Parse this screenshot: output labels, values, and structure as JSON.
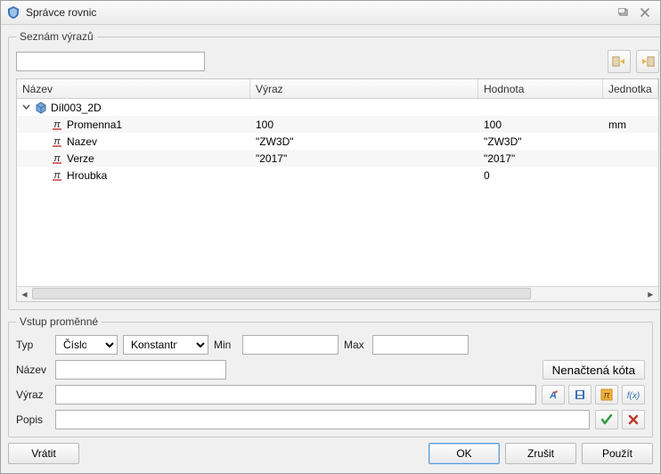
{
  "window": {
    "title": "Správce rovnic"
  },
  "list": {
    "legend": "Seznám výrazů",
    "filter": "",
    "columns": {
      "nazev": "Název",
      "vyraz": "Výraz",
      "hodnota": "Hodnota",
      "jednotka": "Jednotka"
    },
    "root": {
      "name": "Díl003_2D",
      "expanded": true
    },
    "rows": [
      {
        "name": "Promenna1",
        "expr": "100",
        "value": "100",
        "unit": "mm"
      },
      {
        "name": "Nazev",
        "expr": "\"ZW3D\"",
        "value": "\"ZW3D\"",
        "unit": ""
      },
      {
        "name": "Verze",
        "expr": "\"2017\"",
        "value": "\"2017\"",
        "unit": ""
      },
      {
        "name": "Hroubka",
        "expr": "",
        "value": "0",
        "unit": ""
      }
    ]
  },
  "input": {
    "legend": "Vstup proměnné",
    "typ_label": "Typ",
    "typ_value": "Číslo",
    "konst_value": "Konstantní",
    "min_label": "Min",
    "min_value": "",
    "max_label": "Max",
    "max_value": "",
    "nazev_label": "Název",
    "nazev_value": "",
    "unloaded_dim": "Nenačtená kóta",
    "vyraz_label": "Výraz",
    "vyraz_value": "",
    "popis_label": "Popis",
    "popis_value": ""
  },
  "footer": {
    "reset": "Vrátit",
    "ok": "OK",
    "cancel": "Zrušit",
    "apply": "Použít"
  }
}
